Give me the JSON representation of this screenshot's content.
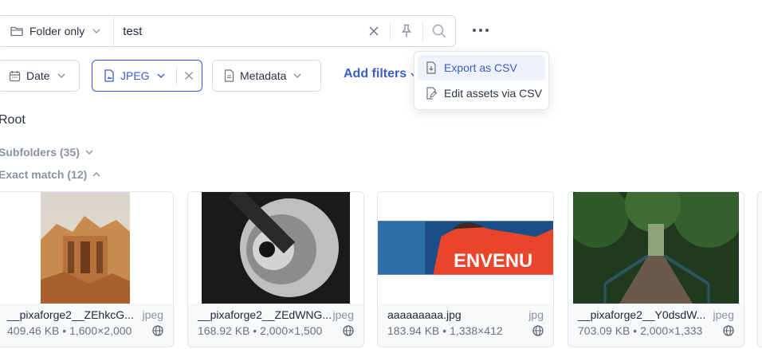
{
  "search": {
    "scope_label": "Folder only",
    "query": "test"
  },
  "filters": {
    "date_label": "Date",
    "type_label": "JPEG",
    "metadata_label": "Metadata",
    "add_label": "Add filters"
  },
  "menu": {
    "items": [
      {
        "label": "Export as CSV"
      },
      {
        "label": "Edit assets via CSV"
      }
    ]
  },
  "breadcrumb": {
    "root": "Root"
  },
  "sections": {
    "subfolders": "Subfolders (35)",
    "exact_match": "Exact match (12)"
  },
  "assets": [
    {
      "name": "__pixaforge2__ZEhkcG...",
      "type": "jpeg",
      "meta": "409.46 KB • 1,600×2,000"
    },
    {
      "name": "__pixaforge2__ZEdWNG...",
      "type": "jpeg",
      "meta": "168.92 KB • 2,000×1,500"
    },
    {
      "name": "aaaaaaaaa.jpg",
      "type": "jpg",
      "meta": "183.94 KB • 1,338×412"
    },
    {
      "name": "__pixaforge2__Y0dsdW...",
      "type": "jpeg",
      "meta": "703.09 KB • 2,000×1,333"
    }
  ],
  "colors": {
    "accent": "#3b5bcc",
    "muted": "#8a93a1",
    "border": "#d6dbe3"
  }
}
